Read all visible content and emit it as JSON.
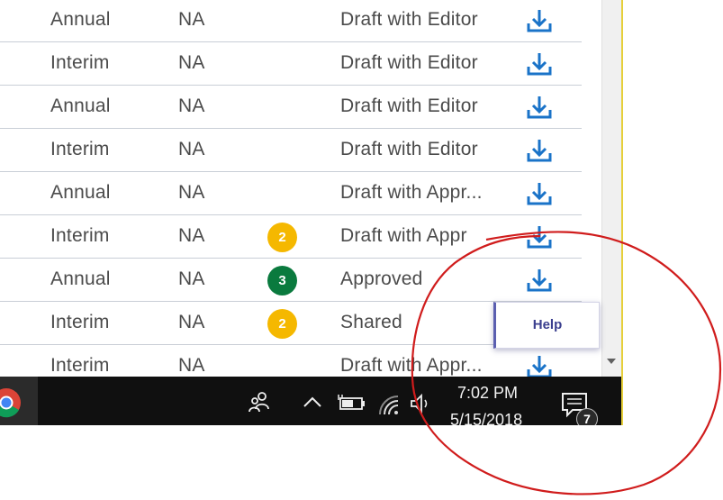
{
  "table": {
    "rows": [
      {
        "type": "Annual",
        "na": "NA",
        "badge": "",
        "status": "Draft with Editor"
      },
      {
        "type": "Interim",
        "na": "NA",
        "badge": "",
        "status": "Draft with Editor"
      },
      {
        "type": "Annual",
        "na": "NA",
        "badge": "",
        "status": "Draft with Editor"
      },
      {
        "type": "Interim",
        "na": "NA",
        "badge": "",
        "status": "Draft with Editor"
      },
      {
        "type": "Annual",
        "na": "NA",
        "badge": "",
        "status": "Draft with Appr..."
      },
      {
        "type": "Interim",
        "na": "NA",
        "badge": "2",
        "status": "Draft with Appr"
      },
      {
        "type": "Annual",
        "na": "NA",
        "badge": "3",
        "status": "Approved"
      },
      {
        "type": "Interim",
        "na": "NA",
        "badge": "2",
        "status": "Shared"
      },
      {
        "type": "Interim",
        "na": "NA",
        "badge": "",
        "status": "Draft with Appr..."
      }
    ],
    "download_icon": "download-icon",
    "badge_colors": {
      "2": "#f5b800",
      "3": "#0a7a3e"
    }
  },
  "help": {
    "label": "Help"
  },
  "taskbar": {
    "time": "7:02 PM",
    "date": "5/15/2018",
    "notification_count": "7",
    "icons": [
      "chrome-icon",
      "people-icon",
      "chevron-up-icon",
      "battery-icon",
      "wifi-icon",
      "speaker-icon",
      "action-center-icon"
    ]
  },
  "colors": {
    "accent": "#1a73c8",
    "annotation": "#d01c1c",
    "taskbar": "#101010"
  }
}
